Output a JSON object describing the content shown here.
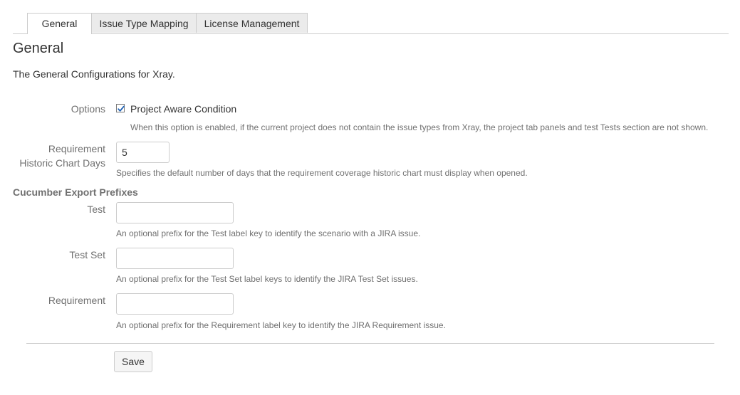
{
  "tabs": [
    {
      "label": "General",
      "active": true
    },
    {
      "label": "Issue Type Mapping",
      "active": false
    },
    {
      "label": "License Management",
      "active": false
    }
  ],
  "page": {
    "title": "General",
    "description": "The General Configurations for Xray."
  },
  "options": {
    "label": "Options",
    "checkbox_label": "Project Aware Condition",
    "checked": true,
    "help": "When this option is enabled, if the current project does not contain the issue types from Xray, the project tab panels and test Tests section are not shown."
  },
  "requirement_days": {
    "label_line1": "Requirement",
    "label_line2": "Historic Chart Days",
    "value": "5",
    "help": "Specifies the default number of days that the requirement coverage historic chart must display when opened."
  },
  "cucumber": {
    "heading": "Cucumber Export Prefixes",
    "test": {
      "label": "Test",
      "value": "",
      "help": "An optional prefix for the Test label key to identify the scenario with a JIRA issue."
    },
    "test_set": {
      "label": "Test Set",
      "value": "",
      "help": "An optional prefix for the Test Set label keys to identify the JIRA Test Set issues."
    },
    "requirement": {
      "label": "Requirement",
      "value": "",
      "help": "An optional prefix for the Requirement label key to identify the JIRA Requirement issue."
    }
  },
  "actions": {
    "save_label": "Save"
  },
  "colors": {
    "checkmark": "#1a5fb4",
    "border": "#cccccc",
    "muted_text": "#707070"
  }
}
